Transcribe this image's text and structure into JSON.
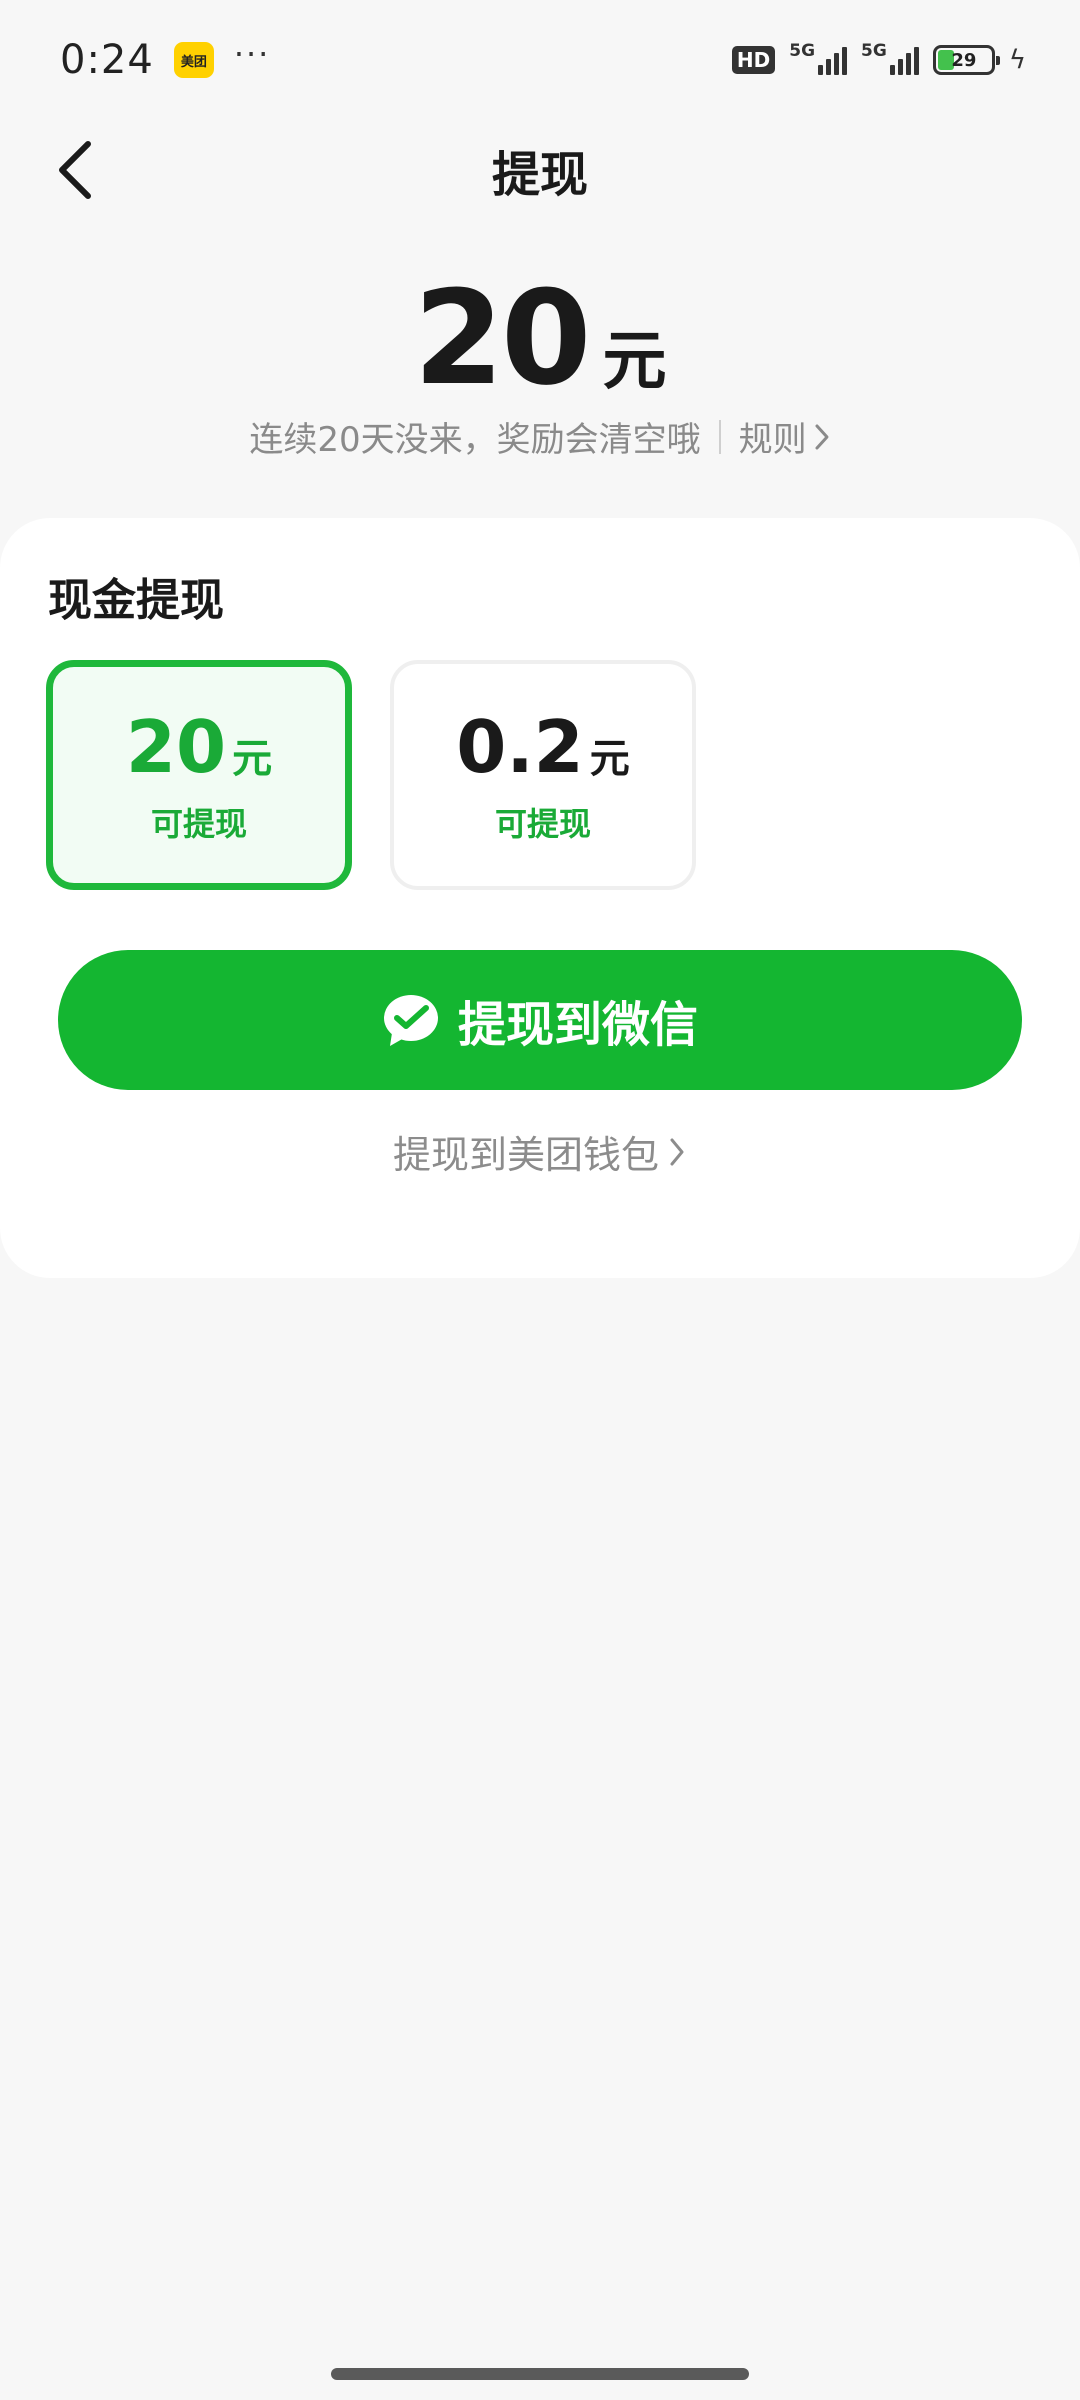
{
  "status_bar": {
    "time": "0:24",
    "app_badge": "美团",
    "more": "···",
    "hd": "HD",
    "network_1": "5G",
    "network_2": "5G",
    "battery": "29"
  },
  "header": {
    "title": "提现"
  },
  "balance": {
    "amount": "20",
    "unit": "元",
    "notice": "连续20天没来，奖励会清空哦",
    "rules_label": "规则"
  },
  "cash_withdraw": {
    "title": "现金提现",
    "options": [
      {
        "amount": "20",
        "unit": "元",
        "label": "可提现",
        "selected": true
      },
      {
        "amount": "0.2",
        "unit": "元",
        "label": "可提现",
        "selected": false
      }
    ],
    "wechat_button_label": "提现到微信",
    "wallet_link_label": "提现到美团钱包"
  },
  "colors": {
    "accent_green": "#14b631",
    "selected_border": "#1fb83b",
    "meituan_yellow": "#ffd100"
  }
}
